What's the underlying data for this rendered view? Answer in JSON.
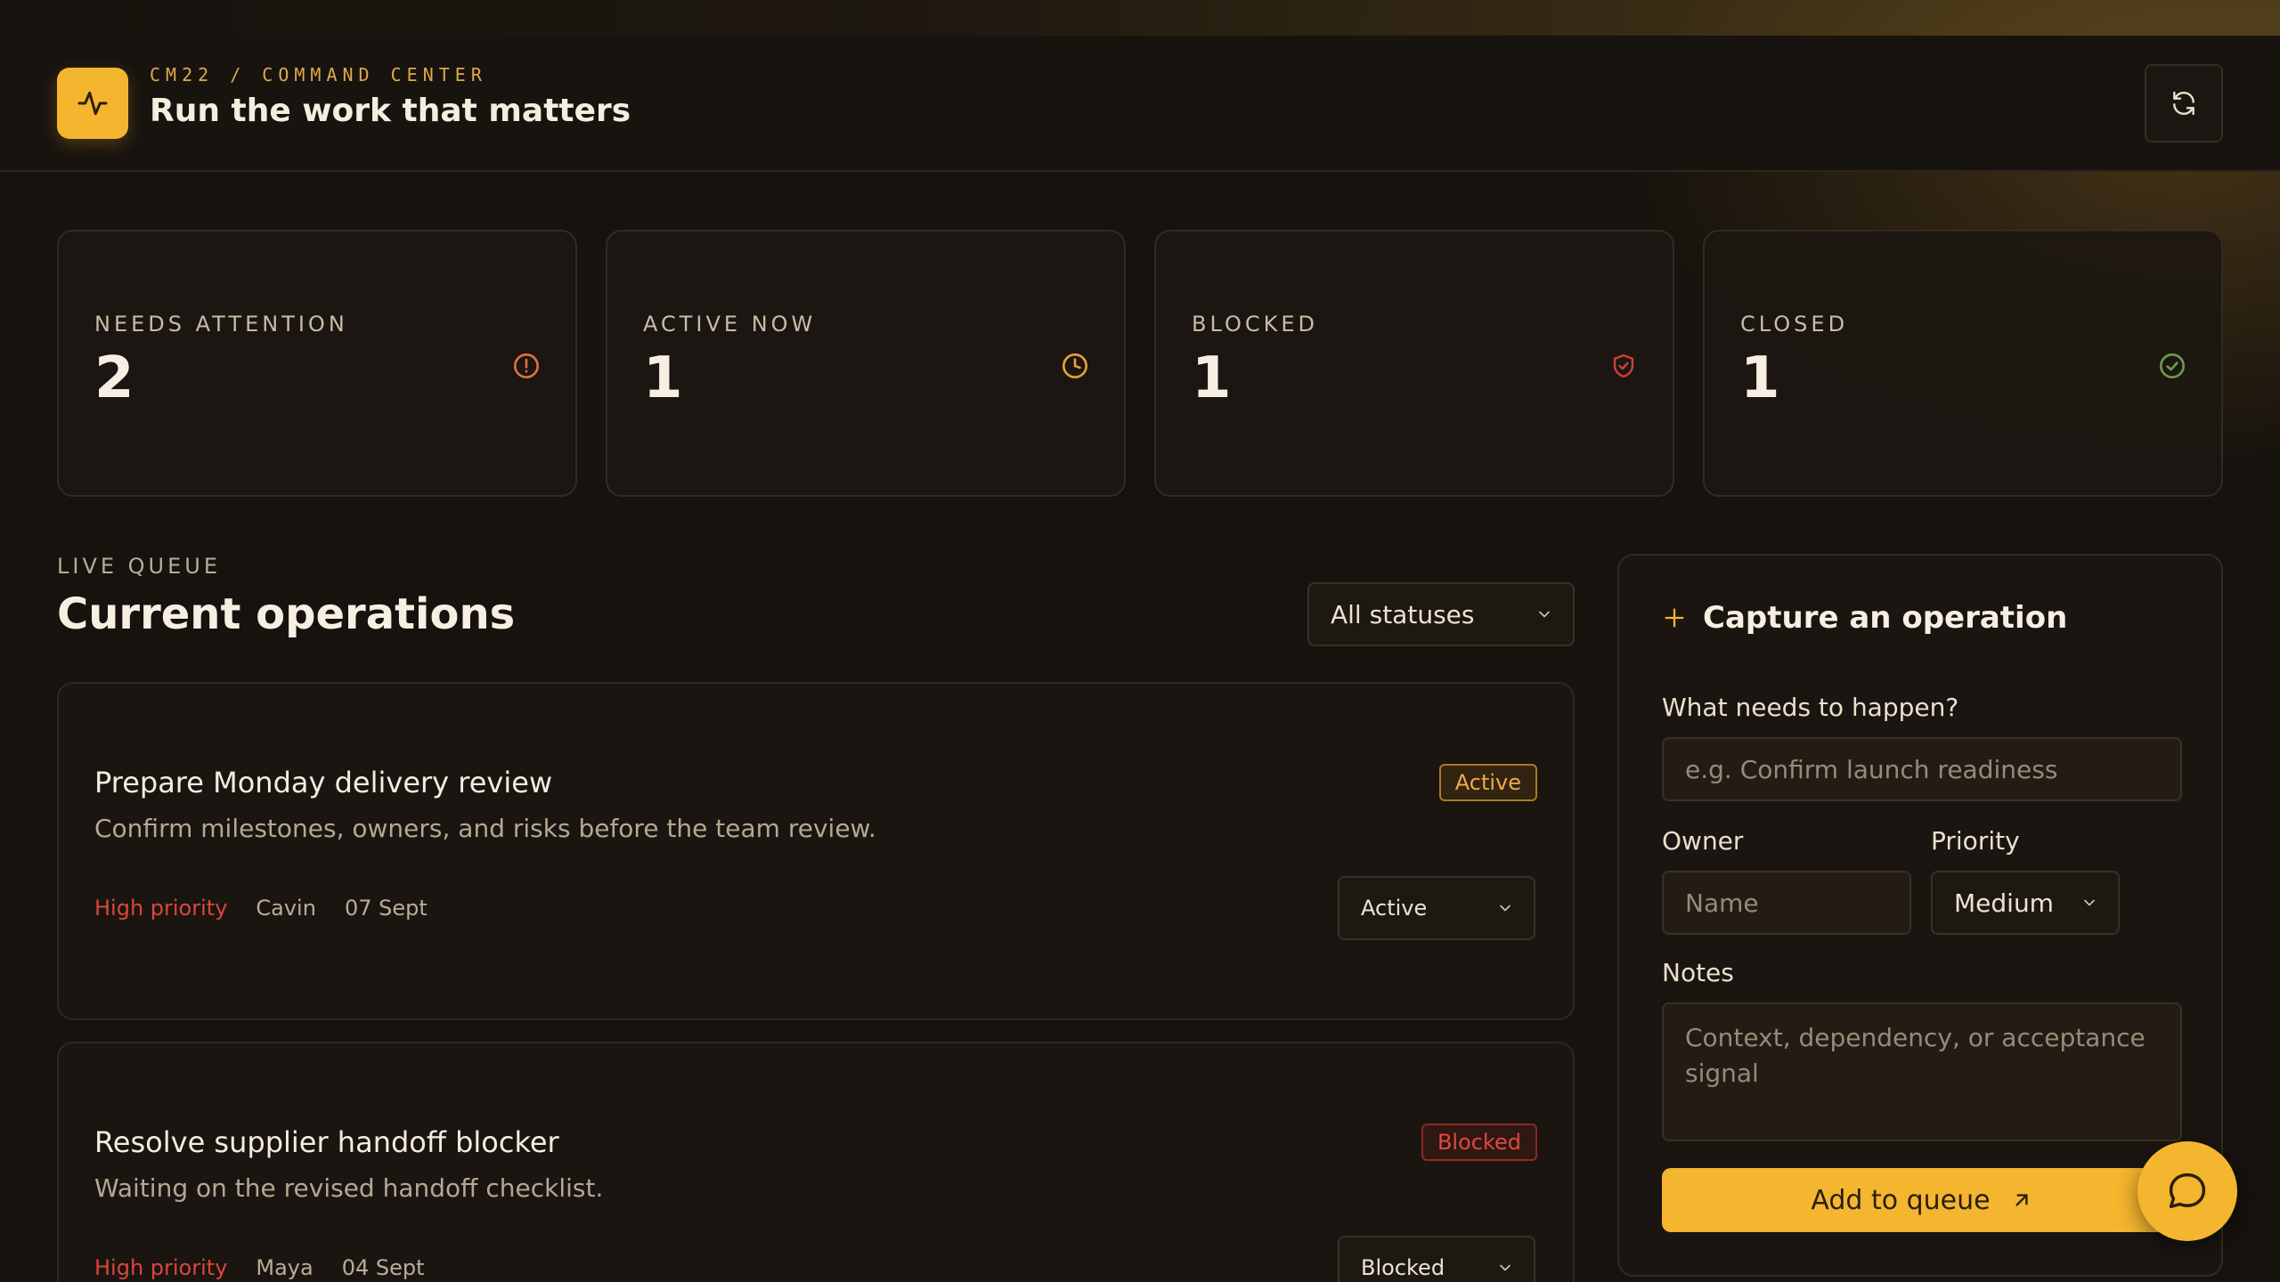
{
  "header": {
    "brand_eyebrow": "CM22 / COMMAND CENTER",
    "title": "Run the work that matters",
    "refresh_icon": "refresh-icon"
  },
  "stats": [
    {
      "label": "NEEDS ATTENTION",
      "value": "2",
      "icon": "alert-circle-icon",
      "color": "#e0713a"
    },
    {
      "label": "ACTIVE NOW",
      "value": "1",
      "icon": "clock-icon",
      "color": "#e6a03a"
    },
    {
      "label": "BLOCKED",
      "value": "1",
      "icon": "shield-icon",
      "color": "#c9413a"
    },
    {
      "label": "CLOSED",
      "value": "1",
      "icon": "check-circle-icon",
      "color": "#6f9a4e"
    }
  ],
  "queue": {
    "eyebrow": "LIVE QUEUE",
    "title": "Current operations",
    "filter": {
      "selected": "All statuses"
    }
  },
  "operations": [
    {
      "title": "Prepare Monday delivery review",
      "description": "Confirm milestones, owners, and risks before the team review.",
      "priority": "High priority",
      "owner": "Cavin",
      "date": "07 Sept",
      "badge": "Active",
      "status_select": "Active"
    },
    {
      "title": "Resolve supplier handoff blocker",
      "description": "Waiting on the revised handoff checklist.",
      "priority": "High priority",
      "owner": "Maya",
      "date": "04 Sept",
      "badge": "Blocked",
      "status_select": "Blocked"
    }
  ],
  "form": {
    "title": "Capture an operation",
    "task_label": "What needs to happen?",
    "task_placeholder": "e.g. Confirm launch readiness",
    "owner_label": "Owner",
    "owner_placeholder": "Name",
    "priority_label": "Priority",
    "priority_selected": "Medium",
    "notes_label": "Notes",
    "notes_placeholder": "Context, dependency, or acceptance signal",
    "submit_label": "Add to queue"
  },
  "colors": {
    "accent": "#f4b52f",
    "background": "#16120d",
    "priority_high": "#d9473b"
  }
}
